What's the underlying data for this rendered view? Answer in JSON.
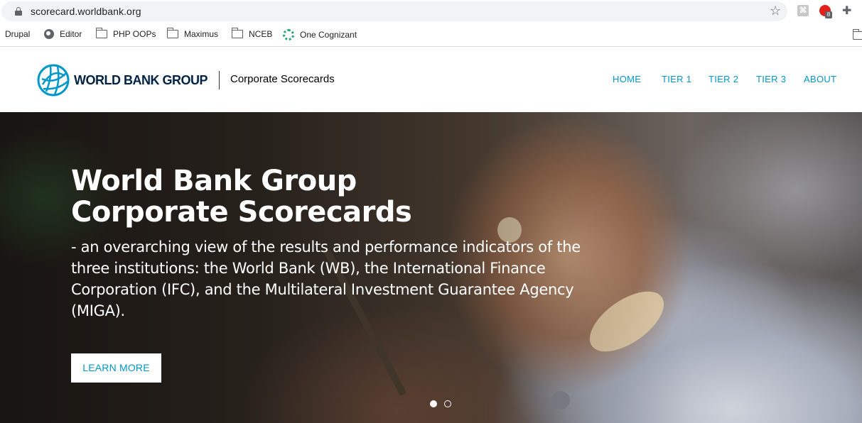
{
  "browser": {
    "url": "scorecard.worldbank.org",
    "bookmarks": [
      {
        "label": "Drupal",
        "icon": "none"
      },
      {
        "label": "Editor",
        "icon": "globe-icon"
      },
      {
        "label": "PHP OOPs",
        "icon": "folder-icon"
      },
      {
        "label": "Maximus",
        "icon": "folder-icon"
      },
      {
        "label": "NCEB",
        "icon": "folder-icon"
      },
      {
        "label": "One Cognizant",
        "icon": "cognizant-icon"
      }
    ],
    "extension_badge": "8"
  },
  "header": {
    "logo_text": "WORLD BANK GROUP",
    "subtitle": "Corporate Scorecards",
    "nav": [
      "HOME",
      "TIER 1",
      "TIER 2",
      "TIER 3",
      "ABOUT"
    ],
    "accent_color": "#0098c8"
  },
  "hero": {
    "title": "World Bank Group Corporate Scorecards",
    "description": "- an overarching view of the results and performance indicators of the three institutions: the World Bank (WB), the International Finance Corporation (IFC), and the Multilateral Investment Guarantee Agency (MIGA).",
    "button_label": "LEARN MORE",
    "slides": 2,
    "active_slide": 1
  }
}
